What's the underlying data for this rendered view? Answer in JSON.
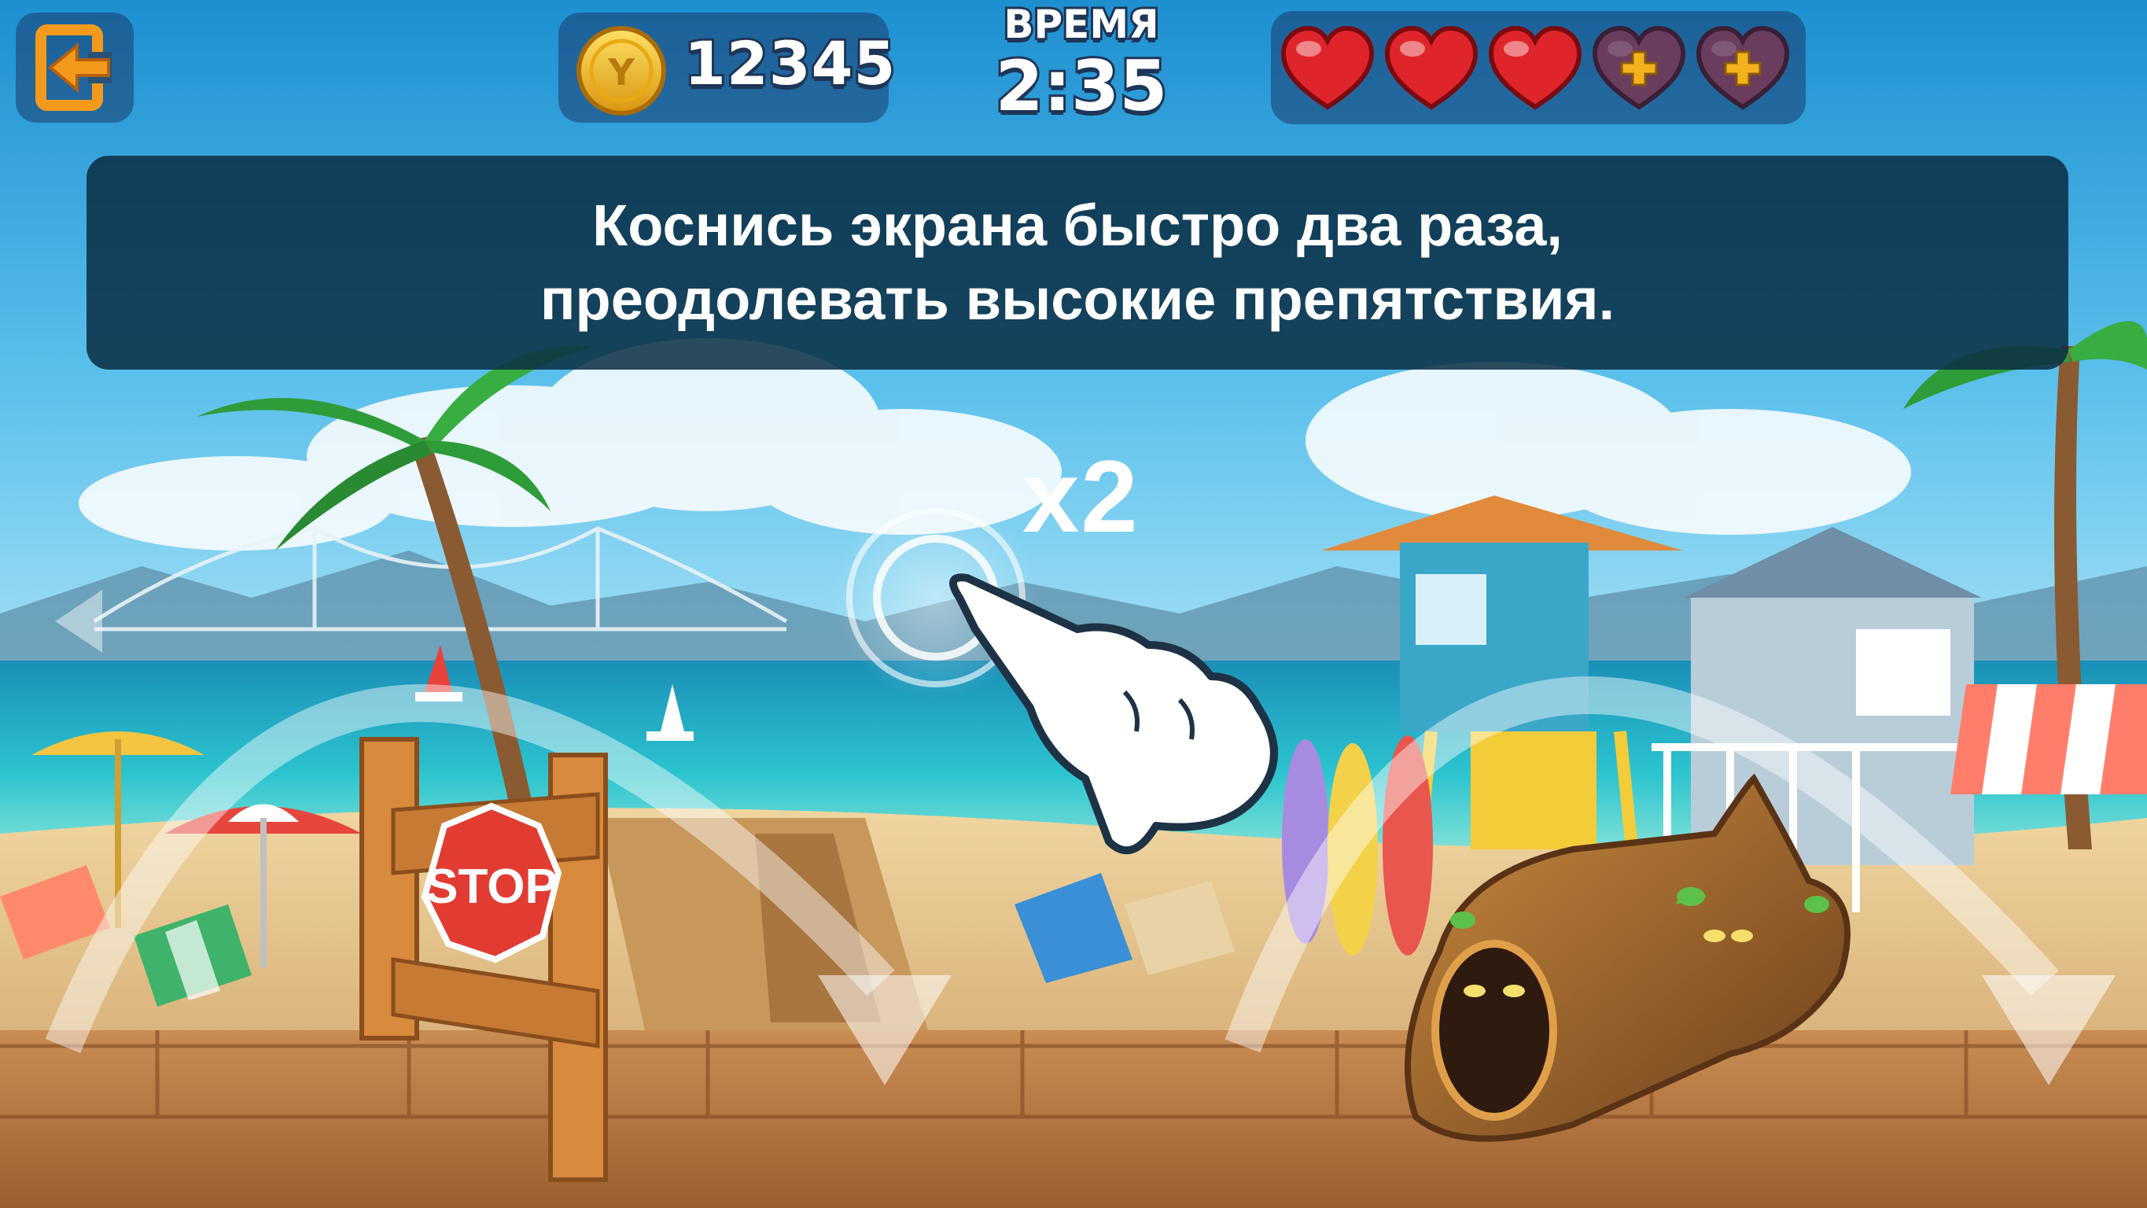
{
  "hud": {
    "exit_icon": "exit-door-arrow-icon",
    "coin_icon": "coin-icon",
    "coin_symbol": "Y",
    "coins": "12345",
    "time_label": "ВРЕМЯ",
    "time_value": "2:35",
    "lives": {
      "filled": 3,
      "empty": 2,
      "filled_icon": "heart-icon",
      "empty_icon": "heart-plus-icon"
    }
  },
  "tutorial": {
    "line1": "Коснись экрана быстро два раза,",
    "line2": "преодолевать высокие препятствия.",
    "tap_count": "x2",
    "hand_icon": "tap-hand-icon"
  },
  "obstacles": {
    "stop_sign_text": "STOP"
  },
  "colors": {
    "sky_top": "#2a9ad6",
    "sea": "#25b7c9",
    "sand": "#e3c08a",
    "boardwalk": "#b97b45",
    "banner_bg": "#0a2d44",
    "heart_red": "#e0242b",
    "heart_empty": "#6a3c5e",
    "coin_gold": "#f3c321",
    "exit_orange": "#f39a1d"
  }
}
